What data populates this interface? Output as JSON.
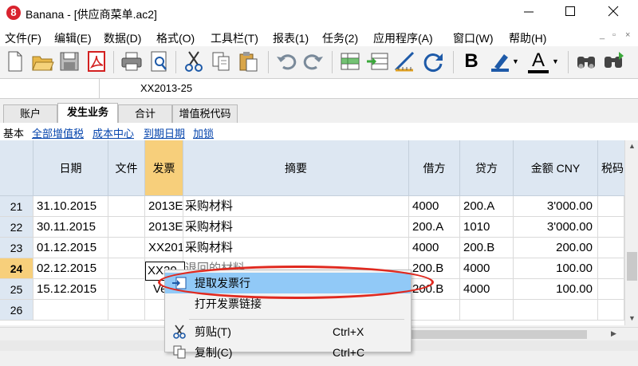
{
  "window": {
    "app_logo": "8",
    "title": "Banana - [供应商菜单.ac2]",
    "min_icon": "minimize-icon",
    "max_icon": "maximize-icon",
    "close_icon": "close-icon"
  },
  "menubar": {
    "items": [
      "文件(F)",
      "编辑(E)",
      "数据(D)",
      "格式(O)",
      "工具栏(T)",
      "报表(1)",
      "任务(2)",
      "应用程序(A)",
      "窗口(W)",
      "帮助(H)"
    ],
    "mdi_controls": [
      "_",
      "▫",
      "×"
    ]
  },
  "toolbar": {
    "icons": [
      "new-file-icon",
      "open-folder-icon",
      "save-icon",
      "pdf-icon",
      "print-icon",
      "print-preview-icon",
      "cut-icon",
      "copy-icon",
      "paste-icon",
      "undo-icon",
      "redo-icon",
      "add-row-icon",
      "insert-row-icon",
      "ruler-icon",
      "refresh-icon",
      "bold-icon",
      "highlight-icon",
      "font-color-icon",
      "find-icon",
      "find-replace-icon"
    ],
    "bold_label": "B",
    "font_color_label": "A",
    "colors": {
      "pdf": "#d32020",
      "highlight": "#1e5aa8",
      "font_color": "#000000"
    }
  },
  "cellbar": {
    "ref": "",
    "value": "XX2013-25"
  },
  "tabs": [
    {
      "label": "账户",
      "active": false
    },
    {
      "label": "发生业务",
      "active": true
    },
    {
      "label": "合计",
      "active": false
    },
    {
      "label": "增值税代码",
      "active": false
    }
  ],
  "views": [
    {
      "label": "基本",
      "current": true
    },
    {
      "label": "全部增值税",
      "current": false
    },
    {
      "label": "成本中心",
      "current": false
    },
    {
      "label": "到期日期",
      "current": false
    },
    {
      "label": "加锁",
      "current": false
    }
  ],
  "grid": {
    "columns": [
      "",
      "日期",
      "文件",
      "发票",
      "摘要",
      "借方",
      "贷方",
      "金额 CNY",
      "税码"
    ],
    "selected_column": "发票",
    "current_row": "24",
    "rows": [
      {
        "rn": "21",
        "date": "31.10.2015",
        "doc": "",
        "invoice": "2013E",
        "desc": "采购材料",
        "debit": "4000",
        "credit": "200.A",
        "amount": "3'000.00"
      },
      {
        "rn": "22",
        "date": "30.11.2015",
        "doc": "",
        "invoice": "2013E",
        "desc": "采购材料",
        "debit": "200.A",
        "credit": "1010",
        "amount": "3'000.00"
      },
      {
        "rn": "23",
        "date": "01.12.2015",
        "doc": "",
        "invoice": "XX201",
        "desc": "采购材料",
        "debit": "4000",
        "credit": "200.B",
        "amount": "200.00"
      },
      {
        "rn": "24",
        "date": "02.12.2015",
        "doc": "",
        "invoice": "XX20",
        "desc": "退回的材料",
        "debit": "200.B",
        "credit": "4000",
        "amount": "100.00"
      },
      {
        "rn": "25",
        "date": "15.12.2015",
        "doc": "",
        "invoice": "Ve",
        "desc": "",
        "debit": "200.B",
        "credit": "4000",
        "amount": "100.00"
      },
      {
        "rn": "26",
        "date": "",
        "doc": "",
        "invoice": "",
        "desc": "",
        "debit": "",
        "credit": "",
        "amount": ""
      }
    ]
  },
  "context_menu": {
    "items": [
      {
        "label": "提取发票行",
        "shortcut": "",
        "icon": "extract-invoice-icon",
        "highlighted": true
      },
      {
        "label": "打开发票链接",
        "shortcut": "",
        "icon": "",
        "highlighted": false
      },
      {
        "label": "剪贴(T)",
        "shortcut": "Ctrl+X",
        "icon": "scissors-icon",
        "highlighted": false
      },
      {
        "label": "复制(C)",
        "shortcut": "Ctrl+C",
        "icon": "copy-icon",
        "highlighted": false
      }
    ]
  },
  "annotation": {
    "ring_color": "#e0291f"
  }
}
